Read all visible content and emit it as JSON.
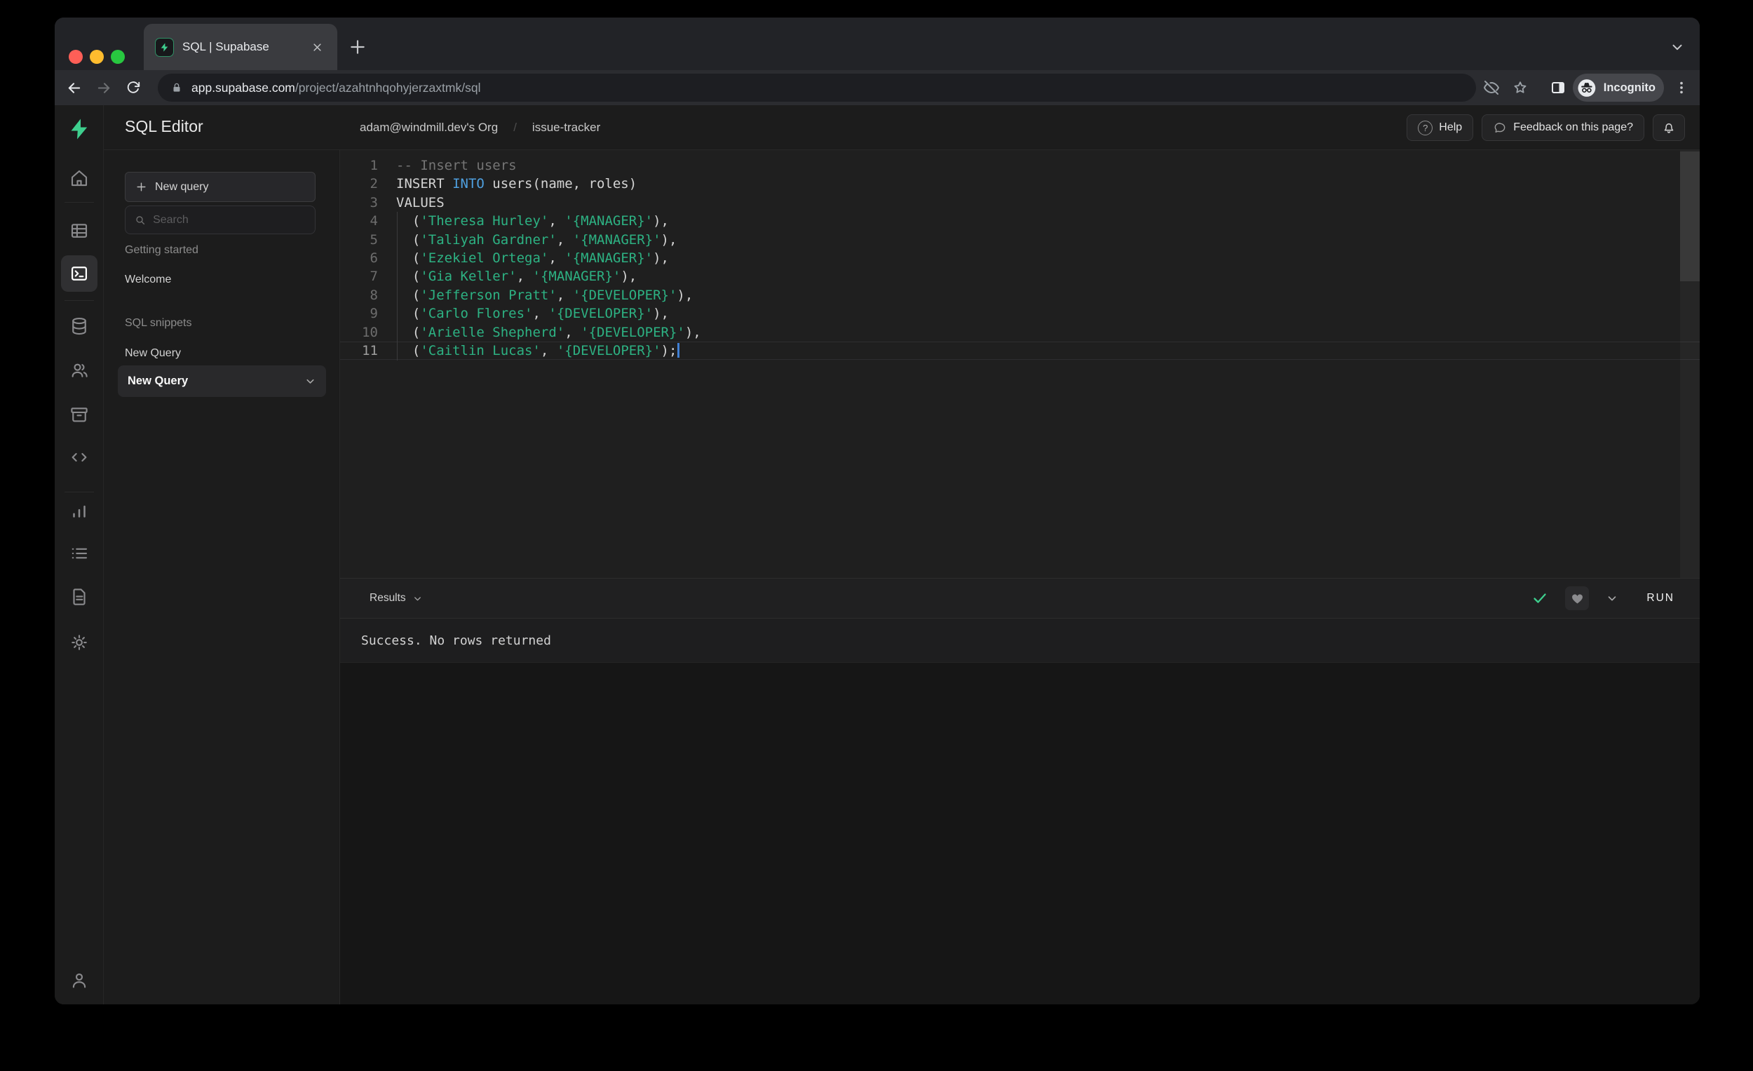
{
  "browser": {
    "tab_title": "SQL | Supabase",
    "url_domain": "app.supabase.com",
    "url_path": "/project/azahtnhqohyjerzaxtmk/sql",
    "incognito_label": "Incognito"
  },
  "app_header": {
    "title": "SQL Editor",
    "breadcrumb_org": "adam@windmill.dev's Org",
    "breadcrumb_separator": "/",
    "breadcrumb_project": "issue-tracker",
    "help_label": "Help",
    "help_icon_glyph": "?",
    "feedback_label": "Feedback on this page?"
  },
  "sidebar": {
    "new_query_button": "New query",
    "search_placeholder": "Search",
    "sections": [
      {
        "label": "Getting started",
        "items": [
          {
            "label": "Welcome"
          }
        ]
      },
      {
        "label": "SQL snippets",
        "items": [
          {
            "label": "New Query"
          },
          {
            "label": "New Query",
            "active": true
          }
        ]
      }
    ]
  },
  "editor": {
    "lines": [
      {
        "num": 1,
        "tokens": [
          {
            "c": "comment",
            "t": "-- Insert users"
          }
        ]
      },
      {
        "num": 2,
        "tokens": [
          {
            "c": "plain",
            "t": "INSERT "
          },
          {
            "c": "keyword",
            "t": "INTO"
          },
          {
            "c": "plain",
            "t": " users(name, roles)"
          }
        ]
      },
      {
        "num": 3,
        "tokens": [
          {
            "c": "plain",
            "t": "VALUES"
          }
        ]
      },
      {
        "num": 4,
        "tokens": [
          {
            "c": "plain",
            "t": "  ("
          },
          {
            "c": "string",
            "t": "'Theresa Hurley'"
          },
          {
            "c": "plain",
            "t": ", "
          },
          {
            "c": "string",
            "t": "'{MANAGER}'"
          },
          {
            "c": "plain",
            "t": "),"
          }
        ]
      },
      {
        "num": 5,
        "tokens": [
          {
            "c": "plain",
            "t": "  ("
          },
          {
            "c": "string",
            "t": "'Taliyah Gardner'"
          },
          {
            "c": "plain",
            "t": ", "
          },
          {
            "c": "string",
            "t": "'{MANAGER}'"
          },
          {
            "c": "plain",
            "t": "),"
          }
        ]
      },
      {
        "num": 6,
        "tokens": [
          {
            "c": "plain",
            "t": "  ("
          },
          {
            "c": "string",
            "t": "'Ezekiel Ortega'"
          },
          {
            "c": "plain",
            "t": ", "
          },
          {
            "c": "string",
            "t": "'{MANAGER}'"
          },
          {
            "c": "plain",
            "t": "),"
          }
        ]
      },
      {
        "num": 7,
        "tokens": [
          {
            "c": "plain",
            "t": "  ("
          },
          {
            "c": "string",
            "t": "'Gia Keller'"
          },
          {
            "c": "plain",
            "t": ", "
          },
          {
            "c": "string",
            "t": "'{MANAGER}'"
          },
          {
            "c": "plain",
            "t": "),"
          }
        ]
      },
      {
        "num": 8,
        "tokens": [
          {
            "c": "plain",
            "t": "  ("
          },
          {
            "c": "string",
            "t": "'Jefferson Pratt'"
          },
          {
            "c": "plain",
            "t": ", "
          },
          {
            "c": "string",
            "t": "'{DEVELOPER}'"
          },
          {
            "c": "plain",
            "t": "),"
          }
        ]
      },
      {
        "num": 9,
        "tokens": [
          {
            "c": "plain",
            "t": "  ("
          },
          {
            "c": "string",
            "t": "'Carlo Flores'"
          },
          {
            "c": "plain",
            "t": ", "
          },
          {
            "c": "string",
            "t": "'{DEVELOPER}'"
          },
          {
            "c": "plain",
            "t": "),"
          }
        ]
      },
      {
        "num": 10,
        "tokens": [
          {
            "c": "plain",
            "t": "  ("
          },
          {
            "c": "string",
            "t": "'Arielle Shepherd'"
          },
          {
            "c": "plain",
            "t": ", "
          },
          {
            "c": "string",
            "t": "'{DEVELOPER}'"
          },
          {
            "c": "plain",
            "t": "),"
          }
        ]
      },
      {
        "num": 11,
        "current": true,
        "cursor": true,
        "tokens": [
          {
            "c": "plain",
            "t": "  ("
          },
          {
            "c": "string",
            "t": "'Caitlin Lucas'"
          },
          {
            "c": "plain",
            "t": ", "
          },
          {
            "c": "string",
            "t": "'{DEVELOPER}'"
          },
          {
            "c": "plain",
            "t": ");"
          }
        ]
      }
    ]
  },
  "results": {
    "dropdown_label": "Results",
    "run_label": "RUN",
    "message": "Success. No rows returned"
  },
  "colors": {
    "accent_green": "#3ecf8e",
    "keyword_blue": "#4fa0e0",
    "string_green": "#2db283",
    "comment_gray": "#757575",
    "code_plain": "#d4d4d4",
    "cursor_blue": "#3f7fd4",
    "traffic_red": "#ff5f57",
    "traffic_yellow": "#febc2e",
    "traffic_green": "#28c840"
  }
}
